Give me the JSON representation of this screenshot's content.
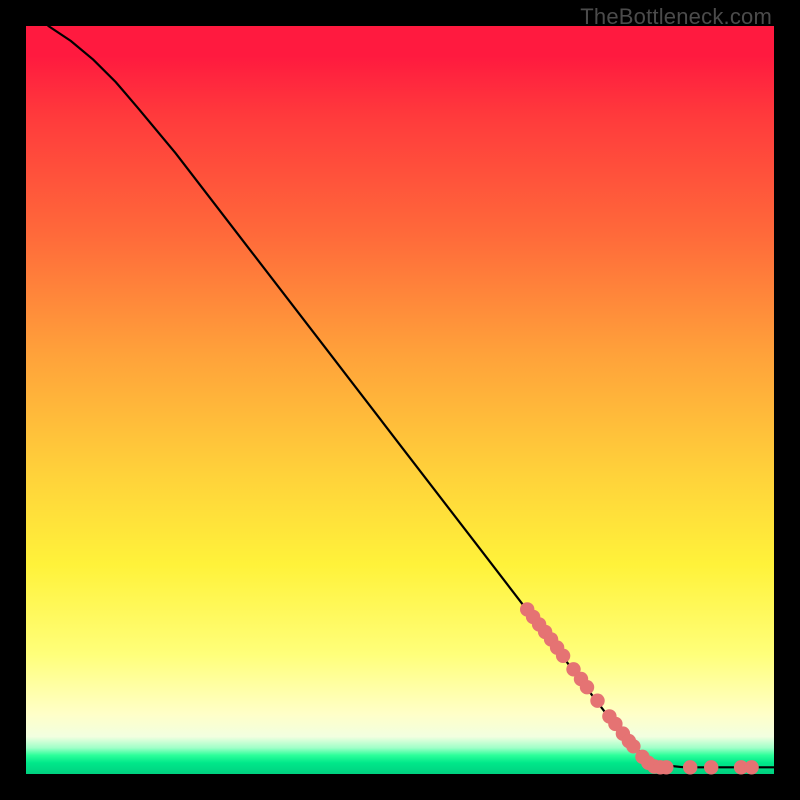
{
  "watermark": "TheBottleneck.com",
  "colors": {
    "marker_fill": "#e57373",
    "marker_stroke": "#c85a5a",
    "curve_stroke": "#000000"
  },
  "chart_data": {
    "type": "line",
    "title": "",
    "xlabel": "",
    "ylabel": "",
    "xlim": [
      0,
      100
    ],
    "ylim": [
      0,
      100
    ],
    "curve": [
      {
        "x": 3,
        "y": 100
      },
      {
        "x": 6,
        "y": 98
      },
      {
        "x": 9,
        "y": 95.5
      },
      {
        "x": 12,
        "y": 92.5
      },
      {
        "x": 15,
        "y": 89
      },
      {
        "x": 20,
        "y": 83
      },
      {
        "x": 30,
        "y": 70
      },
      {
        "x": 40,
        "y": 57
      },
      {
        "x": 50,
        "y": 44
      },
      {
        "x": 60,
        "y": 31
      },
      {
        "x": 70,
        "y": 18
      },
      {
        "x": 78,
        "y": 7.5
      },
      {
        "x": 82,
        "y": 3
      },
      {
        "x": 85,
        "y": 1.2
      },
      {
        "x": 88,
        "y": 0.9
      },
      {
        "x": 92,
        "y": 0.9
      },
      {
        "x": 96,
        "y": 0.9
      },
      {
        "x": 100,
        "y": 0.9
      }
    ],
    "markers": [
      {
        "x": 67.0,
        "y": 22.0
      },
      {
        "x": 67.8,
        "y": 21.0
      },
      {
        "x": 68.6,
        "y": 20.0
      },
      {
        "x": 69.4,
        "y": 19.0
      },
      {
        "x": 70.2,
        "y": 18.0
      },
      {
        "x": 71.0,
        "y": 16.9
      },
      {
        "x": 71.8,
        "y": 15.8
      },
      {
        "x": 73.2,
        "y": 14.0
      },
      {
        "x": 74.2,
        "y": 12.7
      },
      {
        "x": 75.0,
        "y": 11.6
      },
      {
        "x": 76.4,
        "y": 9.8
      },
      {
        "x": 78.0,
        "y": 7.7
      },
      {
        "x": 78.8,
        "y": 6.7
      },
      {
        "x": 79.8,
        "y": 5.4
      },
      {
        "x": 80.6,
        "y": 4.4
      },
      {
        "x": 81.2,
        "y": 3.7
      },
      {
        "x": 82.4,
        "y": 2.3
      },
      {
        "x": 83.2,
        "y": 1.5
      },
      {
        "x": 84.0,
        "y": 1.0
      },
      {
        "x": 84.8,
        "y": 0.9
      },
      {
        "x": 85.6,
        "y": 0.9
      },
      {
        "x": 88.8,
        "y": 0.9
      },
      {
        "x": 91.6,
        "y": 0.9
      },
      {
        "x": 95.6,
        "y": 0.9
      },
      {
        "x": 97.0,
        "y": 0.9
      }
    ]
  }
}
